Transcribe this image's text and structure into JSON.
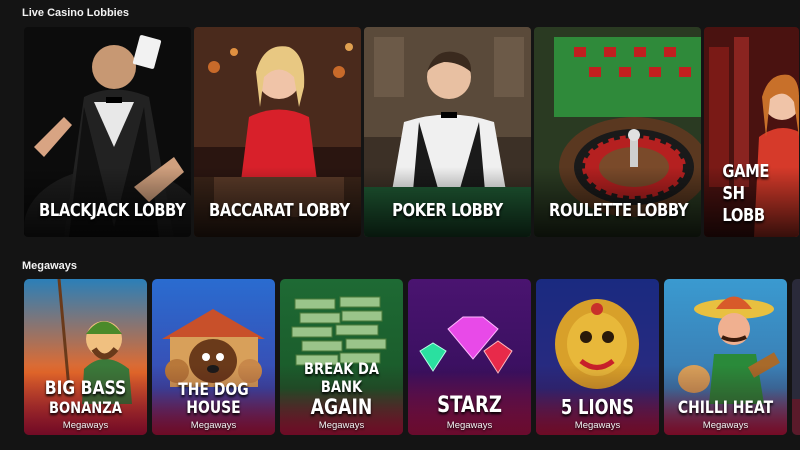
{
  "sections": {
    "live_title": "Live Casino Lobbies",
    "mega_title": "Megaways"
  },
  "lobbies": [
    {
      "label": "BLACKJACK LOBBY",
      "bg": "#1b1b1b"
    },
    {
      "label": "BACCARAT LOBBY",
      "bg": "#3a1a12"
    },
    {
      "label": "POKER LOBBY",
      "bg": "#3b3026"
    },
    {
      "label": "ROULETTE LOBBY",
      "bg": "#2c3b22"
    },
    {
      "label": "GAME SH LOBB",
      "bg": "#4b1410"
    }
  ],
  "megaways": [
    {
      "name1": "BIG BASS",
      "name2": "BONANZA",
      "sub": "Megaways",
      "bg": "#1f6f9c"
    },
    {
      "name1": "THE DOG HOUSE",
      "name2": "",
      "sub": "Megaways",
      "bg": "#2a6cc9"
    },
    {
      "name1": "BREAK DA BANK",
      "name2": "AGAIN",
      "sub": "Megaways",
      "bg": "#1e7a3e"
    },
    {
      "name1": "STARZ",
      "name2": "",
      "sub": "Megaways",
      "bg": "#5a1470"
    },
    {
      "name1": "5 LIONS",
      "name2": "",
      "sub": "Megaways",
      "bg": "#1b2e82"
    },
    {
      "name1": "CHILLI HEAT",
      "name2": "",
      "sub": "Megaways",
      "bg": "#2a8ab5"
    }
  ]
}
